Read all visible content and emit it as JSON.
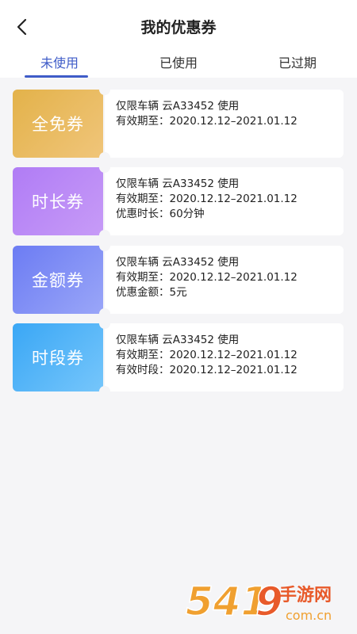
{
  "header": {
    "title": "我的优惠券"
  },
  "tabs": [
    {
      "label": "未使用",
      "active": true
    },
    {
      "label": "已使用",
      "active": false
    },
    {
      "label": "已过期",
      "active": false
    }
  ],
  "coupons": [
    {
      "name": "全免券",
      "color": "#e3b24a",
      "lines": [
        "仅限车辆 云A33452 使用",
        "有效期至：2020.12.12–2021.01.12"
      ]
    },
    {
      "name": "时长券",
      "color": "#b07cf5",
      "lines": [
        "仅限车辆 云A33452 使用",
        "有效期至：2020.12.12–2021.01.12",
        "优惠时长：60分钟"
      ]
    },
    {
      "name": "金额券",
      "color": "#6c7cf3",
      "lines": [
        "仅限车辆 云A33452 使用",
        "有效期至：2020.12.12–2021.01.12",
        "优惠金额：5元"
      ]
    },
    {
      "name": "时段券",
      "color": "#3aa7f5",
      "lines": [
        "仅限车辆 云A33452 使用",
        "有效期至：2020.12.12–2021.01.12",
        "有效时段：2020.12.12–2021.01.12"
      ]
    }
  ],
  "watermark": {
    "text": "54119手游网",
    "subtext": "com.cn",
    "color": "#f0a030"
  }
}
